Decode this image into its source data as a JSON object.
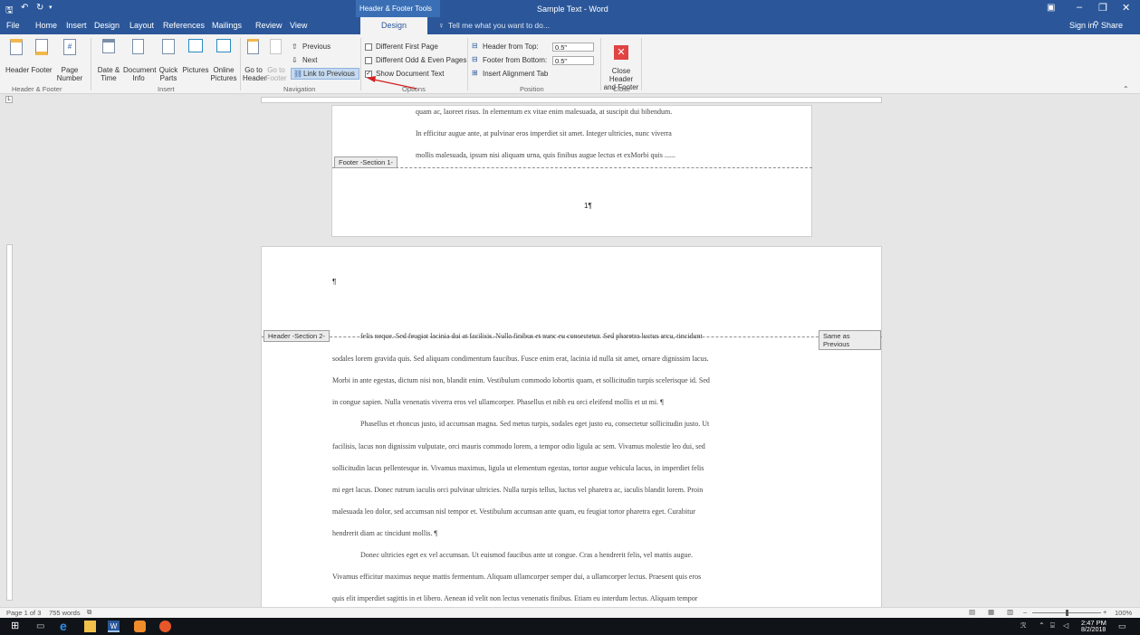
{
  "window": {
    "title": "Sample Text - Word",
    "context_tab_group": "Header & Footer Tools",
    "sign_in": "Sign in",
    "share": "Share"
  },
  "qat": {
    "save_icon": "save-icon",
    "undo_icon": "undo-icon",
    "redo_icon": "redo-icon"
  },
  "tabs": [
    "File",
    "Home",
    "Insert",
    "Design",
    "Layout",
    "References",
    "Mailings",
    "Review",
    "View",
    "Design"
  ],
  "tell_me": "Tell me what you want to do...",
  "ribbon": {
    "header_footer": {
      "header": "Header",
      "footer": "Footer",
      "page_number": "Page Number",
      "group": "Header & Footer"
    },
    "insert": {
      "date_time": "Date & Time",
      "doc_info": "Document Info",
      "quick_parts": "Quick Parts",
      "pictures": "Pictures",
      "online_pictures": "Online Pictures",
      "group": "Insert"
    },
    "navigation": {
      "goto_header": "Go to Header",
      "goto_footer": "Go to Footer",
      "previous": "Previous",
      "next": "Next",
      "link_to_previous": "Link to Previous",
      "group": "Navigation"
    },
    "options": {
      "different_first_page": "Different First Page",
      "different_odd_even": "Different Odd & Even Pages",
      "show_document_text": "Show Document Text",
      "group": "Options"
    },
    "position": {
      "header_from_top": "Header from Top:",
      "header_from_top_value": "0.5\"",
      "footer_from_bottom": "Footer from Bottom:",
      "footer_from_bottom_value": "0.5\"",
      "insert_alignment_tab": "Insert Alignment Tab",
      "group": "Position"
    },
    "close": {
      "label": "Close Header and Footer",
      "group": "Close"
    }
  },
  "doc": {
    "page1_lines": [
      "quam ac, laoreet risus. In elementum ex vitae enim malesuada, at suscipit dui bibendum.",
      "In efficitur augue ante, at pulvinar eros imperdiet sit amet. Integer ultricies, nunc viverra",
      "mollis malesuada, ipsum nisi aliquam urna, quis finibus augue lectus et exMorbi quis ......"
    ],
    "footer_tag": "Footer -Section 1-",
    "page_number": "1¶",
    "header_mark": "¶",
    "header_tag": "Header -Section 2-",
    "same_as_previous": "Same as Previous",
    "page2_lines": [
      "felis neque. Sed feugiat lacinia dui at facilisis. Nulla finibus et nunc eu consectetur. Sed pharetra luctus arcu, tincidunt",
      "sodales lorem gravida quis. Sed aliquam condimentum faucibus. Fusce enim erat, lacinia id nulla sit amet, ornare dignissim lacus.",
      "Morbi in ante egestas, dictum nisi non, blandit enim. Vestibulum commodo lobortis quam, et sollicitudin turpis scelerisque id. Sed",
      "in congue sapien. Nulla venenatis viverra eros vel ullamcorper. Phasellus et nibh eu orci eleifend mollis et ut mi. ¶",
      "Phasellus et rhoncus justo, id accumsan magna. Sed metus turpis, sodales eget justo eu, consectetur sollicitudin justo. Ut",
      "facilisis, lacus non dignissim vulputate, orci mauris commodo lorem, a tempor odio ligula ac sem. Vivamus molestie leo dui, sed",
      "sollicitudin lacus pellentesque in. Vivamus maximus, ligula ut elementum egestas, tortor augue vehicula lacus, in imperdiet felis",
      "mi eget lacus. Donec rutrum iaculis orci pulvinar ultricies. Nulla turpis tellus, luctus vel pharetra ac, iaculis blandit lorem. Proin",
      "malesuada leo dolor, sed accumsan nisl tempor et. Vestibulum accumsan ante quam, eu feugiat tortor pharetra eget. Curabitur",
      "hendrerit diam ac tincidunt mollis. ¶",
      "Donec ultricies eget ex vel accumsan. Ut euismod faucibus ante ut congue. Cras a hendrerit felis, vel mattis augue.",
      "Vivamus efficitur maximus neque mattis fermentum. Aliquam ullamcorper semper dui, a ullamcorper lectus. Praesent quis eros",
      "quis elit imperdiet sagittis in et libero. Aenean id velit non lectus venenatis finibus. Etiam eu interdum lectus. Aliquam tempor"
    ]
  },
  "status": {
    "page": "Page 1 of 3",
    "words": "755 words",
    "zoom": "100%"
  },
  "taskbar": {
    "time": "2:47 PM",
    "date": "8/2/2018"
  },
  "colors": {
    "brand": "#2b579a",
    "close_red": "#e04343",
    "annotation_arrow": "#d42020"
  }
}
